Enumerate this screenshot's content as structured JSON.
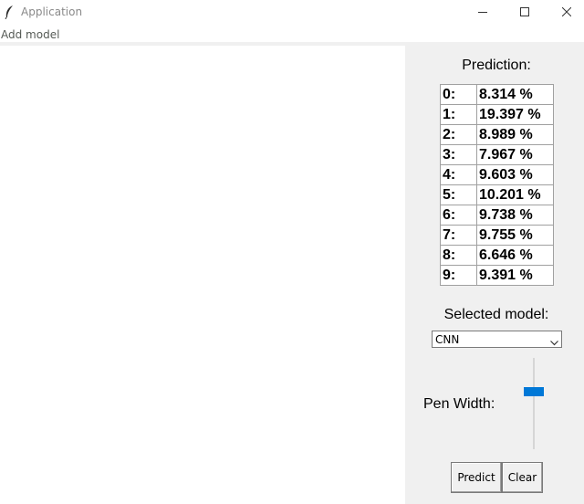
{
  "window": {
    "title": "Application",
    "icons": {
      "app": "feather-icon",
      "minimize": "minimize-icon",
      "maximize": "maximize-icon",
      "close": "close-icon"
    }
  },
  "menu": {
    "items": [
      {
        "label": "Add model"
      }
    ]
  },
  "prediction": {
    "title": "Prediction:",
    "rows": [
      {
        "digit": "0:",
        "value": "8.314 %"
      },
      {
        "digit": "1:",
        "value": "19.397 %"
      },
      {
        "digit": "2:",
        "value": "8.989 %"
      },
      {
        "digit": "3:",
        "value": "7.967 %"
      },
      {
        "digit": "4:",
        "value": "9.603 %"
      },
      {
        "digit": "5:",
        "value": "10.201 %"
      },
      {
        "digit": "6:",
        "value": "9.738 %"
      },
      {
        "digit": "7:",
        "value": "9.755 %"
      },
      {
        "digit": "8:",
        "value": "6.646 %"
      },
      {
        "digit": "9:",
        "value": "9.391 %"
      }
    ]
  },
  "model": {
    "label": "Selected model:",
    "selected": "CNN"
  },
  "pen": {
    "label": "Pen Width:",
    "level": 0.35
  },
  "buttons": {
    "predict": "Predict",
    "clear": "Clear"
  },
  "colors": {
    "accent": "#0078d7",
    "panel_bg": "#f0f0f0",
    "canvas_bg": "#ffffff"
  }
}
